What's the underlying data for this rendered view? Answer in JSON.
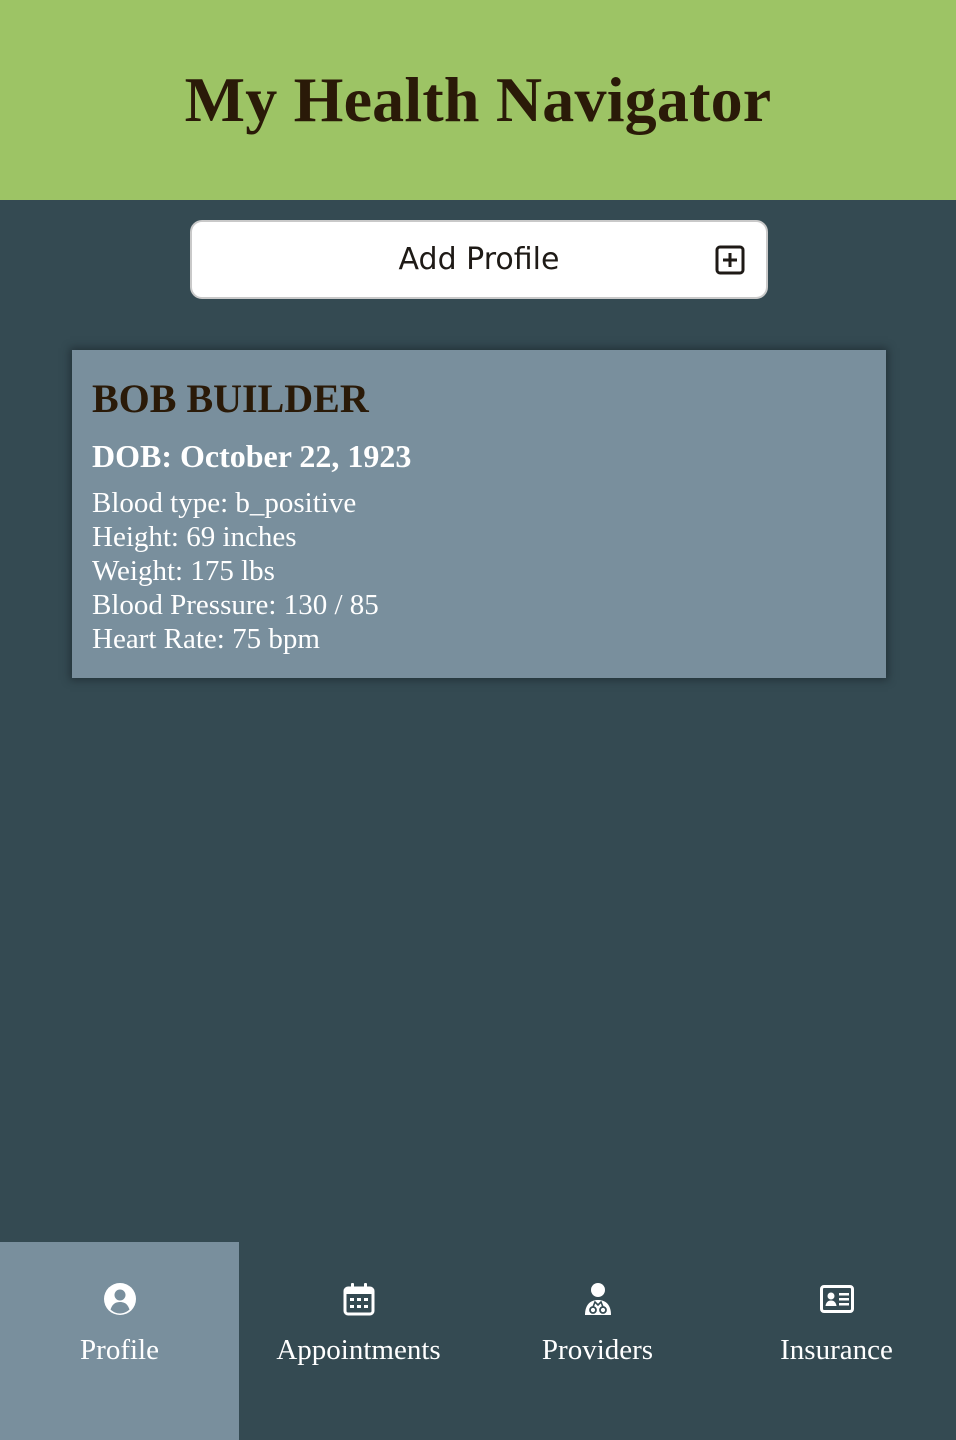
{
  "app": {
    "title": "My Health Navigator"
  },
  "colors": {
    "header_bg": "#9dc465",
    "page_bg": "#344a52",
    "card_bg": "#798f9d",
    "title_text": "#2a1a08"
  },
  "add_profile": {
    "label": "Add Profile",
    "icon": "plus-square-icon"
  },
  "profile_card": {
    "name": "BOB BUILDER",
    "dob": "DOB: October 22, 1923",
    "stats": [
      "Blood type: b_positive",
      "Height: 69 inches",
      "Weight: 175 lbs",
      "Blood Pressure: 130 / 85",
      "Heart Rate: 75 bpm"
    ]
  },
  "nav": {
    "active": "Profile",
    "items": [
      {
        "label": "Profile",
        "icon": "user-circle-icon"
      },
      {
        "label": "Appointments",
        "icon": "calendar-icon"
      },
      {
        "label": "Providers",
        "icon": "doctor-icon"
      },
      {
        "label": "Insurance",
        "icon": "id-card-icon"
      }
    ]
  }
}
